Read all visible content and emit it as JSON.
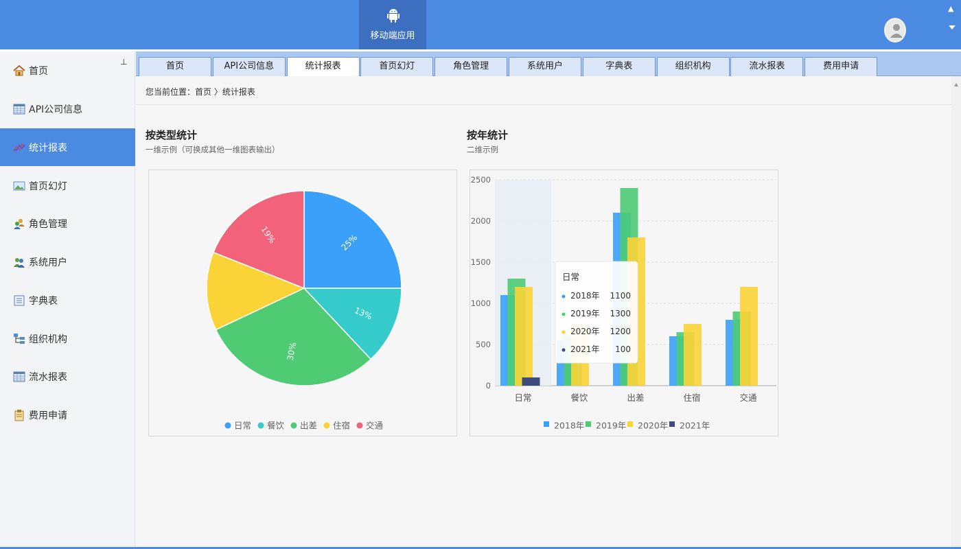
{
  "header": {
    "mobile_app_label": "移动端应用",
    "accent_color": "#4a8ae0"
  },
  "sidebar": {
    "items": [
      {
        "label": "首页",
        "icon": "home-icon"
      },
      {
        "label": "API公司信息",
        "icon": "table-icon"
      },
      {
        "label": "统计报表",
        "icon": "chart-line-icon"
      },
      {
        "label": "首页幻灯",
        "icon": "picture-icon"
      },
      {
        "label": "角色管理",
        "icon": "role-group-icon"
      },
      {
        "label": "系统用户",
        "icon": "users-icon"
      },
      {
        "label": "字典表",
        "icon": "dictionary-icon"
      },
      {
        "label": "组织机构",
        "icon": "org-tree-icon"
      },
      {
        "label": "流水报表",
        "icon": "table-icon"
      },
      {
        "label": "费用申请",
        "icon": "clipboard-icon"
      }
    ]
  },
  "tabs": [
    {
      "label": "首页"
    },
    {
      "label": "API公司信息"
    },
    {
      "label": "统计报表",
      "active": true
    },
    {
      "label": "首页幻灯"
    },
    {
      "label": "角色管理"
    },
    {
      "label": "系统用户"
    },
    {
      "label": "字典表"
    },
    {
      "label": "组织机构"
    },
    {
      "label": "流水报表"
    },
    {
      "label": "费用申请"
    }
  ],
  "breadcrumb": "您当前位置：首页 〉统计报表",
  "pie_section": {
    "title": "按类型统计",
    "subtitle": "一维示例（可换成其他一维图表输出）"
  },
  "bar_section": {
    "title": "按年统计",
    "subtitle": "二维示例"
  },
  "chart_data": [
    {
      "type": "pie",
      "categories": [
        "日常",
        "餐饮",
        "出差",
        "住宿",
        "交通"
      ],
      "values": [
        25,
        13,
        30,
        13,
        19
      ],
      "labels": [
        "25%",
        "13%",
        "30%",
        "",
        "19%"
      ],
      "colors": [
        "#3ba0fa",
        "#36cbcb",
        "#4ecb73",
        "#fad337",
        "#f2637b"
      ],
      "legend": "bottom"
    },
    {
      "type": "bar",
      "categories": [
        "日常",
        "餐饮",
        "出差",
        "住宿",
        "交通"
      ],
      "series": [
        {
          "name": "2018年",
          "color": "#3ba0fa",
          "values": [
            1100,
            550,
            2100,
            600,
            800
          ]
        },
        {
          "name": "2019年",
          "color": "#4ecb73",
          "values": [
            1300,
            600,
            2400,
            650,
            900
          ]
        },
        {
          "name": "2020年",
          "color": "#fad337",
          "values": [
            1200,
            750,
            1800,
            750,
            1200
          ]
        },
        {
          "name": "2021年",
          "color": "#3c4d7c",
          "values": [
            100,
            0,
            0,
            0,
            0
          ]
        }
      ],
      "ylim": [
        0,
        2500
      ],
      "yticks": [
        0,
        500,
        1000,
        1500,
        2000,
        2500
      ],
      "legend": "bottom",
      "grid": true,
      "tooltip": {
        "title": "日常",
        "rows": [
          {
            "name": "2018年",
            "value": "1100"
          },
          {
            "name": "2019年",
            "value": "1300"
          },
          {
            "name": "2020年",
            "value": "1200"
          },
          {
            "name": "2021年",
            "value": "100"
          }
        ]
      }
    }
  ]
}
